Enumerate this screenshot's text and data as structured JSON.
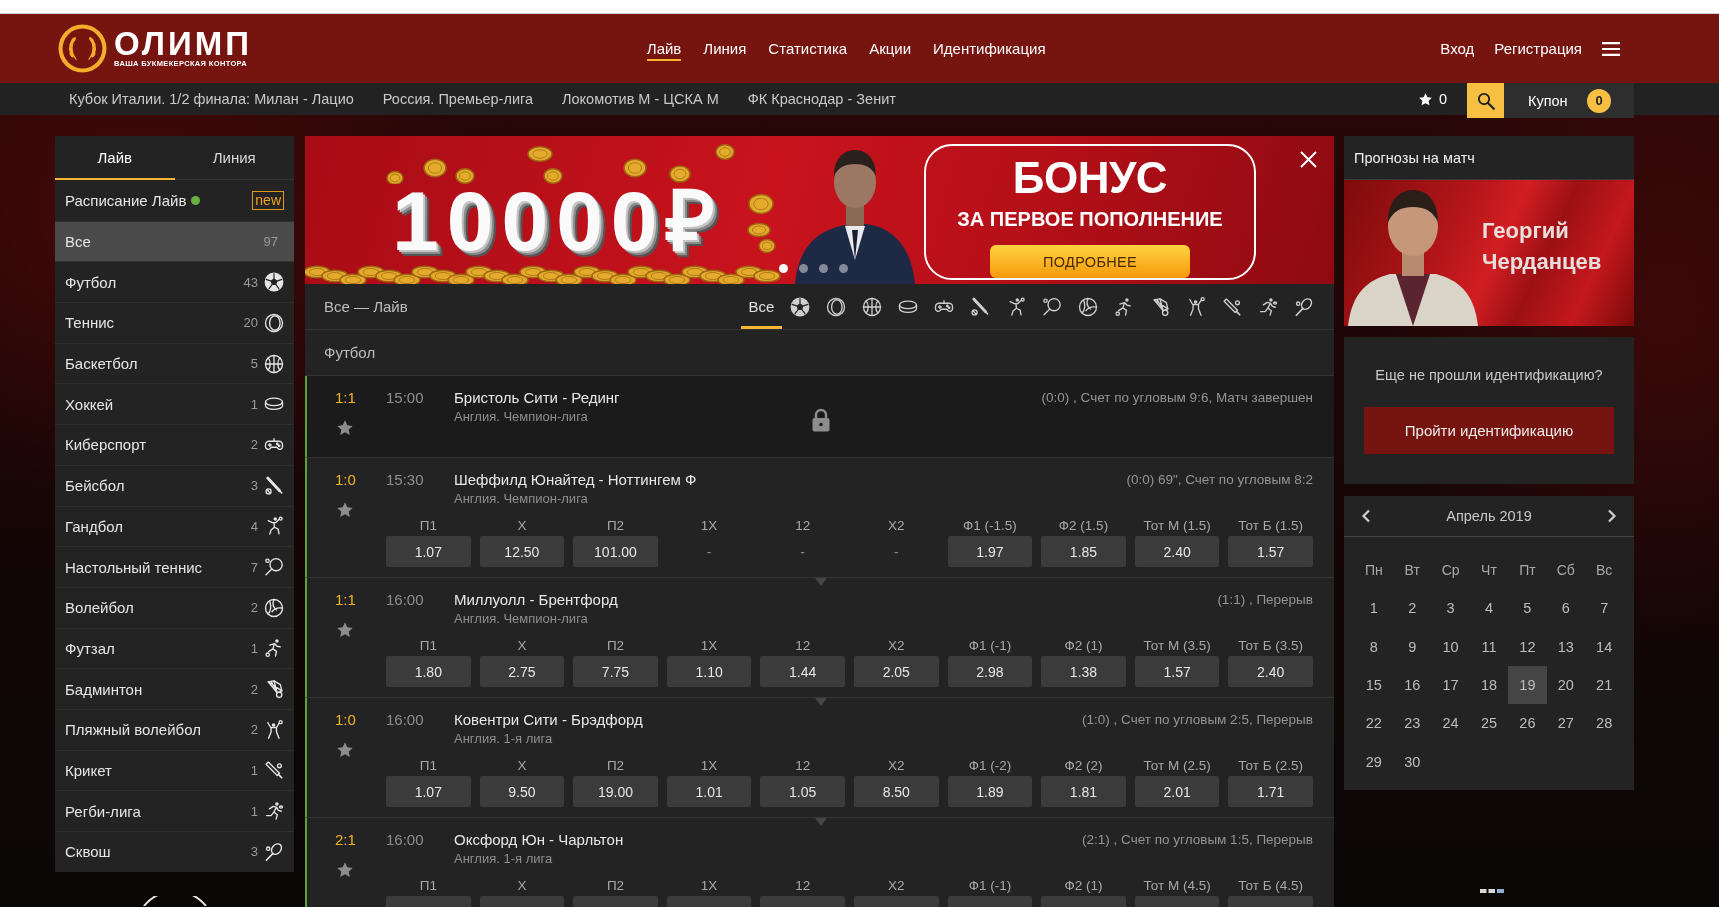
{
  "header": {
    "logo": {
      "name": "ОЛИМП",
      "tagline": "ВАША БУКМЕКЕРСКАЯ КОНТОРА"
    },
    "nav": [
      {
        "label": "Лайв",
        "selected": true
      },
      {
        "label": "Линия",
        "selected": false
      },
      {
        "label": "Статистика",
        "selected": false
      },
      {
        "label": "Акции",
        "selected": false
      },
      {
        "label": "Идентификация",
        "selected": false
      }
    ],
    "account": [
      "Вход",
      "Регистрация"
    ]
  },
  "top_events": [
    "Кубок Италии. 1/2 финала: Милан - Лацио",
    "Россия. Премьер-лига",
    "Локомотив М - ЦСКА М",
    "ФК Краснодар - Зенит"
  ],
  "favorites": {
    "count": "0"
  },
  "coupon": {
    "label": "Купон",
    "count": "0"
  },
  "sidebar": {
    "tabs": [
      {
        "label": "Лайв",
        "selected": true
      },
      {
        "label": "Линия",
        "selected": false
      }
    ],
    "schedule": {
      "label": "Расписание Лайв",
      "badge": "new"
    },
    "items": [
      {
        "label": "Все",
        "count": "97",
        "selected": true
      },
      {
        "label": "Футбол",
        "count": "43",
        "selected": false
      },
      {
        "label": "Теннис",
        "count": "20",
        "selected": false
      },
      {
        "label": "Баскетбол",
        "count": "5",
        "selected": false
      },
      {
        "label": "Хоккей",
        "count": "1",
        "selected": false
      },
      {
        "label": "Киберспорт",
        "count": "2",
        "selected": false
      },
      {
        "label": "Бейсбол",
        "count": "3",
        "selected": false
      },
      {
        "label": "Гандбол",
        "count": "4",
        "selected": false
      },
      {
        "label": "Настольный теннис",
        "count": "7",
        "selected": false
      },
      {
        "label": "Волейбол",
        "count": "2",
        "selected": false
      },
      {
        "label": "Футзал",
        "count": "1",
        "selected": false
      },
      {
        "label": "Бадминтон",
        "count": "2",
        "selected": false
      },
      {
        "label": "Пляжный волейбол",
        "count": "2",
        "selected": false
      },
      {
        "label": "Крикет",
        "count": "1",
        "selected": false
      },
      {
        "label": "Регби-лига",
        "count": "1",
        "selected": false
      },
      {
        "label": "Сквош",
        "count": "3",
        "selected": false
      }
    ]
  },
  "banner": {
    "amount": "10000₽",
    "title": "БОНУС",
    "subtitle": "ЗА ПЕРВОЕ ПОПОЛНЕНИЕ",
    "button": "ПОДРОБНЕЕ",
    "dots": [
      {
        "selected": true
      },
      {
        "selected": false
      },
      {
        "selected": false
      },
      {
        "selected": false
      }
    ]
  },
  "events": {
    "title": "Все — Лайв",
    "filters": [
      {
        "label": "Все",
        "selected": true
      },
      {
        "selected": false
      },
      {
        "selected": false
      },
      {
        "selected": false
      },
      {
        "selected": false
      },
      {
        "selected": false
      },
      {
        "selected": false
      },
      {
        "selected": false
      },
      {
        "selected": false
      },
      {
        "selected": false
      },
      {
        "selected": false
      },
      {
        "selected": false
      },
      {
        "selected": false
      },
      {
        "selected": false
      },
      {
        "selected": false
      },
      {
        "selected": false
      }
    ],
    "section": "Футбол",
    "matches": [
      {
        "score": "1:1",
        "time": "15:00",
        "teams": "Бристоль Сити - Рединг",
        "league": "Англия. Чемпион-лига",
        "info": "(0:0) , Счет по угловым 9:6, Матч завершен",
        "locked": true
      },
      {
        "score": "1:0",
        "time": "15:30",
        "teams": "Шеффилд Юнайтед - Ноттингем Ф",
        "league": "Англия. Чемпион-лига",
        "info": "(0:0) 69\", Счет по угловым 8:2",
        "locked": false,
        "odds": [
          {
            "label": "П1",
            "value": "1.07",
            "disabled": false
          },
          {
            "label": "Х",
            "value": "12.50",
            "disabled": false
          },
          {
            "label": "П2",
            "value": "101.00",
            "disabled": false
          },
          {
            "label": "1Х",
            "value": "-",
            "disabled": true
          },
          {
            "label": "12",
            "value": "-",
            "disabled": true
          },
          {
            "label": "Х2",
            "value": "-",
            "disabled": true
          },
          {
            "label": "Ф1 (-1.5)",
            "value": "1.97",
            "disabled": false
          },
          {
            "label": "Ф2 (1.5)",
            "value": "1.85",
            "disabled": false
          },
          {
            "label": "Тот М (1.5)",
            "value": "2.40",
            "disabled": false
          },
          {
            "label": "Тот Б (1.5)",
            "value": "1.57",
            "disabled": false
          }
        ]
      },
      {
        "score": "1:1",
        "time": "16:00",
        "teams": "Миллуолл - Брентфорд",
        "league": "Англия. Чемпион-лига",
        "info": "(1:1) , Перерыв",
        "locked": false,
        "odds": [
          {
            "label": "П1",
            "value": "1.80",
            "disabled": false
          },
          {
            "label": "Х",
            "value": "2.75",
            "disabled": false
          },
          {
            "label": "П2",
            "value": "7.75",
            "disabled": false
          },
          {
            "label": "1Х",
            "value": "1.10",
            "disabled": false
          },
          {
            "label": "12",
            "value": "1.44",
            "disabled": false
          },
          {
            "label": "Х2",
            "value": "2.05",
            "disabled": false
          },
          {
            "label": "Ф1 (-1)",
            "value": "2.98",
            "disabled": false
          },
          {
            "label": "Ф2 (1)",
            "value": "1.38",
            "disabled": false
          },
          {
            "label": "Тот М (3.5)",
            "value": "1.57",
            "disabled": false
          },
          {
            "label": "Тот Б (3.5)",
            "value": "2.40",
            "disabled": false
          }
        ]
      },
      {
        "score": "1:0",
        "time": "16:00",
        "teams": "Ковентри Сити - Брэдфорд",
        "league": "Англия. 1-я лига",
        "info": "(1:0) , Счет по угловым 2:5, Перерыв",
        "locked": false,
        "odds": [
          {
            "label": "П1",
            "value": "1.07",
            "disabled": false
          },
          {
            "label": "Х",
            "value": "9.50",
            "disabled": false
          },
          {
            "label": "П2",
            "value": "19.00",
            "disabled": false
          },
          {
            "label": "1Х",
            "value": "1.01",
            "disabled": false
          },
          {
            "label": "12",
            "value": "1.05",
            "disabled": false
          },
          {
            "label": "Х2",
            "value": "8.50",
            "disabled": false
          },
          {
            "label": "Ф1 (-2)",
            "value": "1.89",
            "disabled": false
          },
          {
            "label": "Ф2 (2)",
            "value": "1.81",
            "disabled": false
          },
          {
            "label": "Тот М (2.5)",
            "value": "2.01",
            "disabled": false
          },
          {
            "label": "Тот Б (2.5)",
            "value": "1.71",
            "disabled": false
          }
        ]
      },
      {
        "score": "2:1",
        "time": "16:00",
        "teams": "Оксфорд Юн - Чарльтон",
        "league": "Англия. 1-я лига",
        "info": "(2:1) , Счет по угловым 1:5, Перерыв",
        "locked": false,
        "odds": [
          {
            "label": "П1",
            "disabled": false
          },
          {
            "label": "Х",
            "disabled": false
          },
          {
            "label": "П2",
            "disabled": false
          },
          {
            "label": "1Х",
            "disabled": false
          },
          {
            "label": "12",
            "disabled": false
          },
          {
            "label": "Х2",
            "disabled": false
          },
          {
            "label": "Ф1 (-1)",
            "disabled": false
          },
          {
            "label": "Ф2 (1)",
            "disabled": false
          },
          {
            "label": "Тот М (4.5)",
            "disabled": false
          },
          {
            "label": "Тот Б (4.5)",
            "disabled": false
          }
        ]
      }
    ]
  },
  "aside": {
    "forecasts": {
      "title": "Прогнозы на матч",
      "expert": "Георгий Черданцев"
    },
    "identification": {
      "text": "Еще не прошли идентификацию?",
      "button": "Пройти идентификацию"
    },
    "calendar": {
      "month": "Апрель 2019",
      "weekdays": [
        "Пн",
        "Вт",
        "Ср",
        "Чт",
        "Пт",
        "Сб",
        "Вс"
      ],
      "days": [
        {
          "label": "1",
          "selected": false
        },
        {
          "label": "2",
          "selected": false
        },
        {
          "label": "3",
          "selected": false
        },
        {
          "label": "4",
          "selected": false
        },
        {
          "label": "5",
          "selected": false
        },
        {
          "label": "6",
          "selected": false
        },
        {
          "label": "7",
          "selected": false
        },
        {
          "label": "8",
          "selected": false
        },
        {
          "label": "9",
          "selected": false
        },
        {
          "label": "10",
          "selected": false
        },
        {
          "label": "11",
          "selected": false
        },
        {
          "label": "12",
          "selected": false
        },
        {
          "label": "13",
          "selected": false
        },
        {
          "label": "14",
          "selected": false
        },
        {
          "label": "15",
          "selected": false
        },
        {
          "label": "16",
          "selected": false
        },
        {
          "label": "17",
          "selected": false
        },
        {
          "label": "18",
          "selected": false
        },
        {
          "label": "19",
          "selected": true
        },
        {
          "label": "20",
          "selected": false
        },
        {
          "label": "21",
          "selected": false
        },
        {
          "label": "22",
          "selected": false
        },
        {
          "label": "23",
          "selected": false
        },
        {
          "label": "24",
          "selected": false
        },
        {
          "label": "25",
          "selected": false
        },
        {
          "label": "26",
          "selected": false
        },
        {
          "label": "27",
          "selected": false
        },
        {
          "label": "28",
          "selected": false
        },
        {
          "label": "29",
          "selected": false
        },
        {
          "label": "30",
          "selected": false
        }
      ]
    }
  }
}
